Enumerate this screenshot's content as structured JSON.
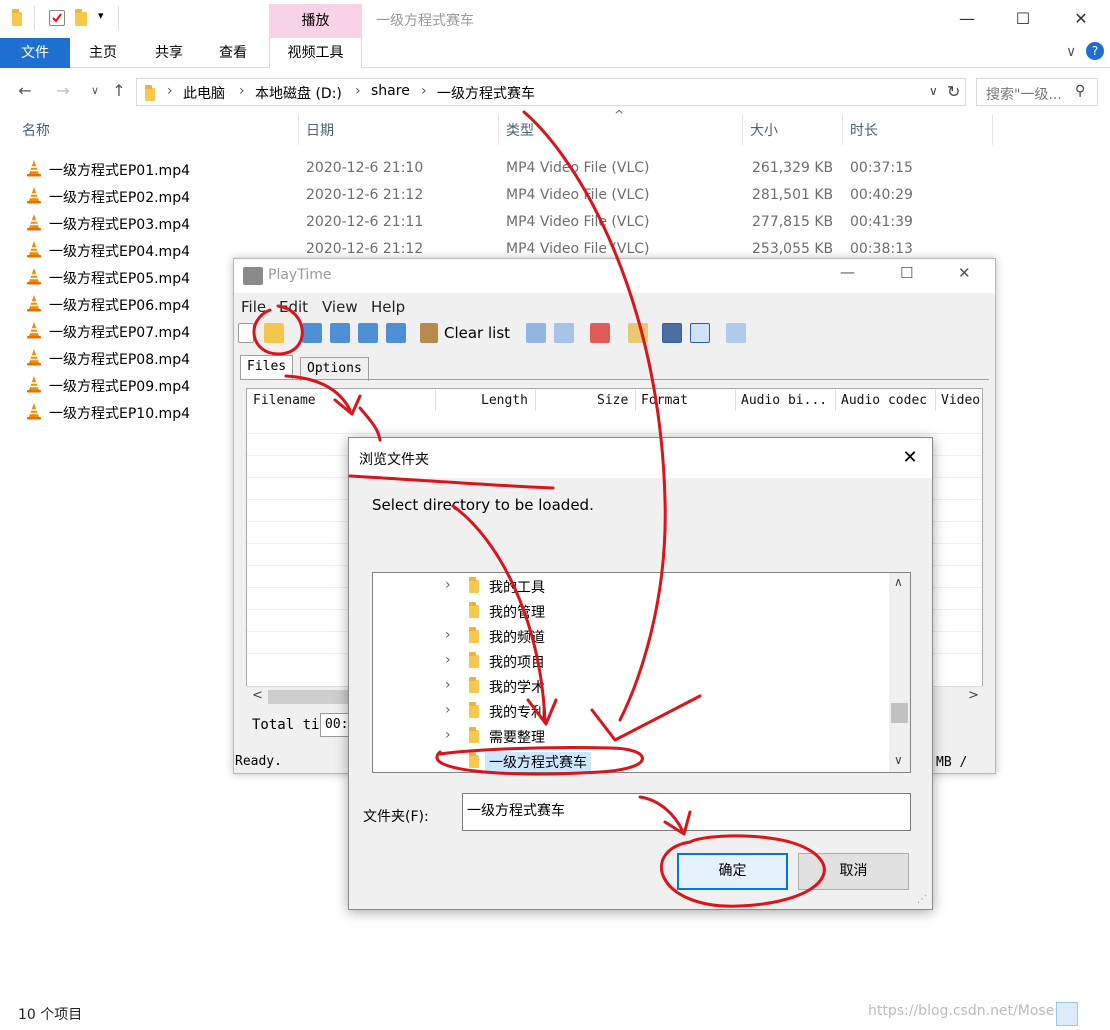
{
  "explorer": {
    "ribbon_context_tab": "播放",
    "window_title": "一级方程式赛车",
    "ribbon_tabs": [
      "文件",
      "主页",
      "共享",
      "查看",
      "视频工具"
    ],
    "breadcrumbs": [
      "此电脑",
      "本地磁盘 (D:)",
      "share",
      "一级方程式赛车"
    ],
    "search_placeholder": "搜索\"一级...",
    "columns": [
      "名称",
      "日期",
      "类型",
      "大小",
      "时长"
    ],
    "files": [
      {
        "name": "一级方程式EP01.mp4",
        "date": "2020-12-6 21:10",
        "type": "MP4 Video File (VLC)",
        "size": "261,329 KB",
        "duration": "00:37:15"
      },
      {
        "name": "一级方程式EP02.mp4",
        "date": "2020-12-6 21:12",
        "type": "MP4 Video File (VLC)",
        "size": "281,501 KB",
        "duration": "00:40:29"
      },
      {
        "name": "一级方程式EP03.mp4",
        "date": "2020-12-6 21:11",
        "type": "MP4 Video File (VLC)",
        "size": "277,815 KB",
        "duration": "00:41:39"
      },
      {
        "name": "一级方程式EP04.mp4",
        "date": "2020-12-6 21:12",
        "type": "MP4 Video File (VLC)",
        "size": "253,055 KB",
        "duration": "00:38:13"
      },
      {
        "name": "一级方程式EP05.mp4"
      },
      {
        "name": "一级方程式EP06.mp4"
      },
      {
        "name": "一级方程式EP07.mp4"
      },
      {
        "name": "一级方程式EP08.mp4"
      },
      {
        "name": "一级方程式EP09.mp4"
      },
      {
        "name": "一级方程式EP10.mp4"
      }
    ],
    "status_text": "10 个项目",
    "watermark": "https://blog.csdn.net/Mose"
  },
  "playtime": {
    "title": "PlayTime",
    "menu": [
      "File",
      "Edit",
      "View",
      "Help"
    ],
    "clear_list": "Clear list",
    "tabs": [
      "Files",
      "Options"
    ],
    "list_columns": [
      "Filename",
      "Length",
      "Size",
      "Format",
      "Audio bi...",
      "Audio codec",
      "Video"
    ],
    "total_label": "Total ti",
    "total_value": "00:",
    "status": "Ready.",
    "status_right": "MB /"
  },
  "dialog": {
    "title": "浏览文件夹",
    "message": "Select directory to be loaded.",
    "tree_items": [
      {
        "label": "我的工具",
        "expandable": true
      },
      {
        "label": "我的管理",
        "expandable": false
      },
      {
        "label": "我的频道",
        "expandable": true
      },
      {
        "label": "我的项目",
        "expandable": true
      },
      {
        "label": "我的学术",
        "expandable": true
      },
      {
        "label": "我的专利",
        "expandable": true
      },
      {
        "label": "需要整理",
        "expandable": true
      },
      {
        "label": "一级方程式赛车",
        "expandable": false,
        "selected": true
      }
    ],
    "folder_label": "文件夹(F):",
    "folder_value": "一级方程式赛车",
    "ok": "确定",
    "cancel": "取消"
  },
  "colors": {
    "accent": "#1f6fd1",
    "annotation": "#d9141b",
    "context_tab": "#f8d2e6"
  }
}
